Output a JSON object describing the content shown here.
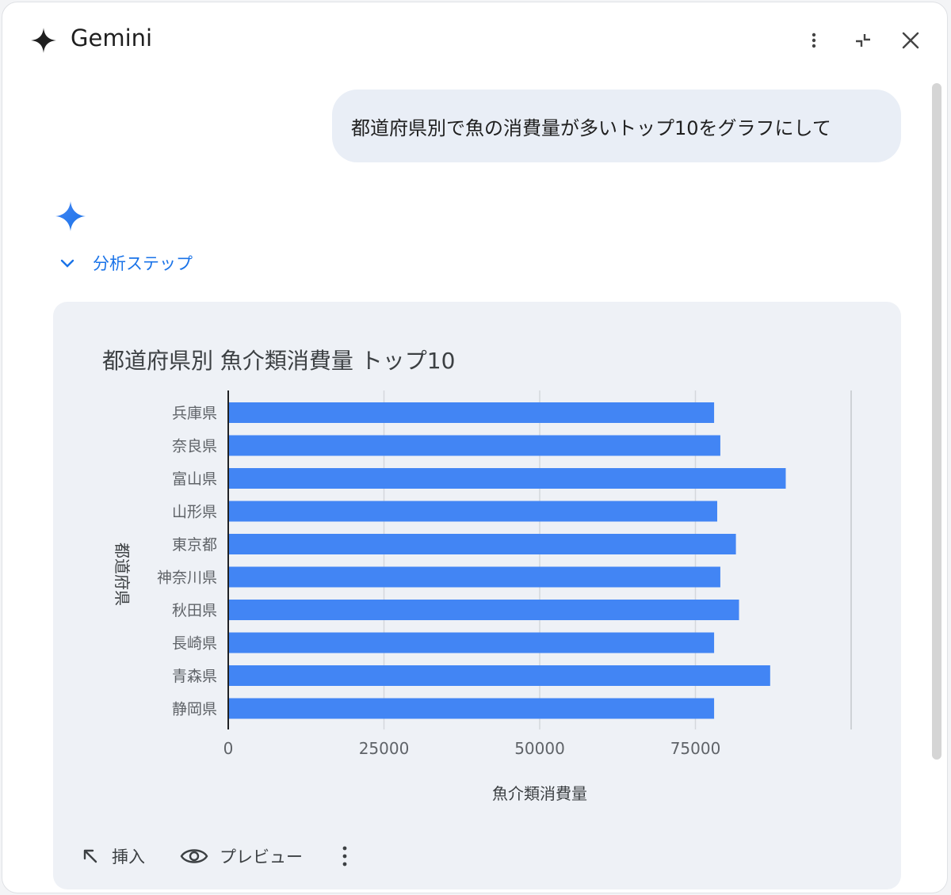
{
  "header": {
    "title": "Gemini",
    "icons": [
      "more-vert-icon",
      "collapse-icon",
      "close-icon"
    ]
  },
  "conversation": {
    "user_message": "都道府県別で魚の消費量が多いトップ10をグラフにして",
    "analysis_steps_label": "分析ステップ"
  },
  "chart_actions": {
    "insert_label": "挿入",
    "preview_label": "プレビュー"
  },
  "colors": {
    "accent": "#1a73e8",
    "bar": "#4285f4",
    "bubble": "#e9eef6",
    "card": "#eef1f6"
  },
  "chart_data": {
    "type": "bar",
    "orientation": "horizontal",
    "title": "都道府県別 魚介類消費量 トップ10",
    "xlabel": "魚介類消費量",
    "ylabel": "都道府県",
    "categories": [
      "兵庫県",
      "奈良県",
      "富山県",
      "山形県",
      "東京都",
      "神奈川県",
      "秋田県",
      "長崎県",
      "青森県",
      "静岡県"
    ],
    "values": [
      78000,
      79000,
      89500,
      78500,
      81500,
      79000,
      82000,
      78000,
      87000,
      78000
    ],
    "xlim": [
      0,
      100000
    ],
    "xticks": [
      0,
      25000,
      50000,
      75000
    ],
    "grid": true,
    "legend": "none"
  }
}
